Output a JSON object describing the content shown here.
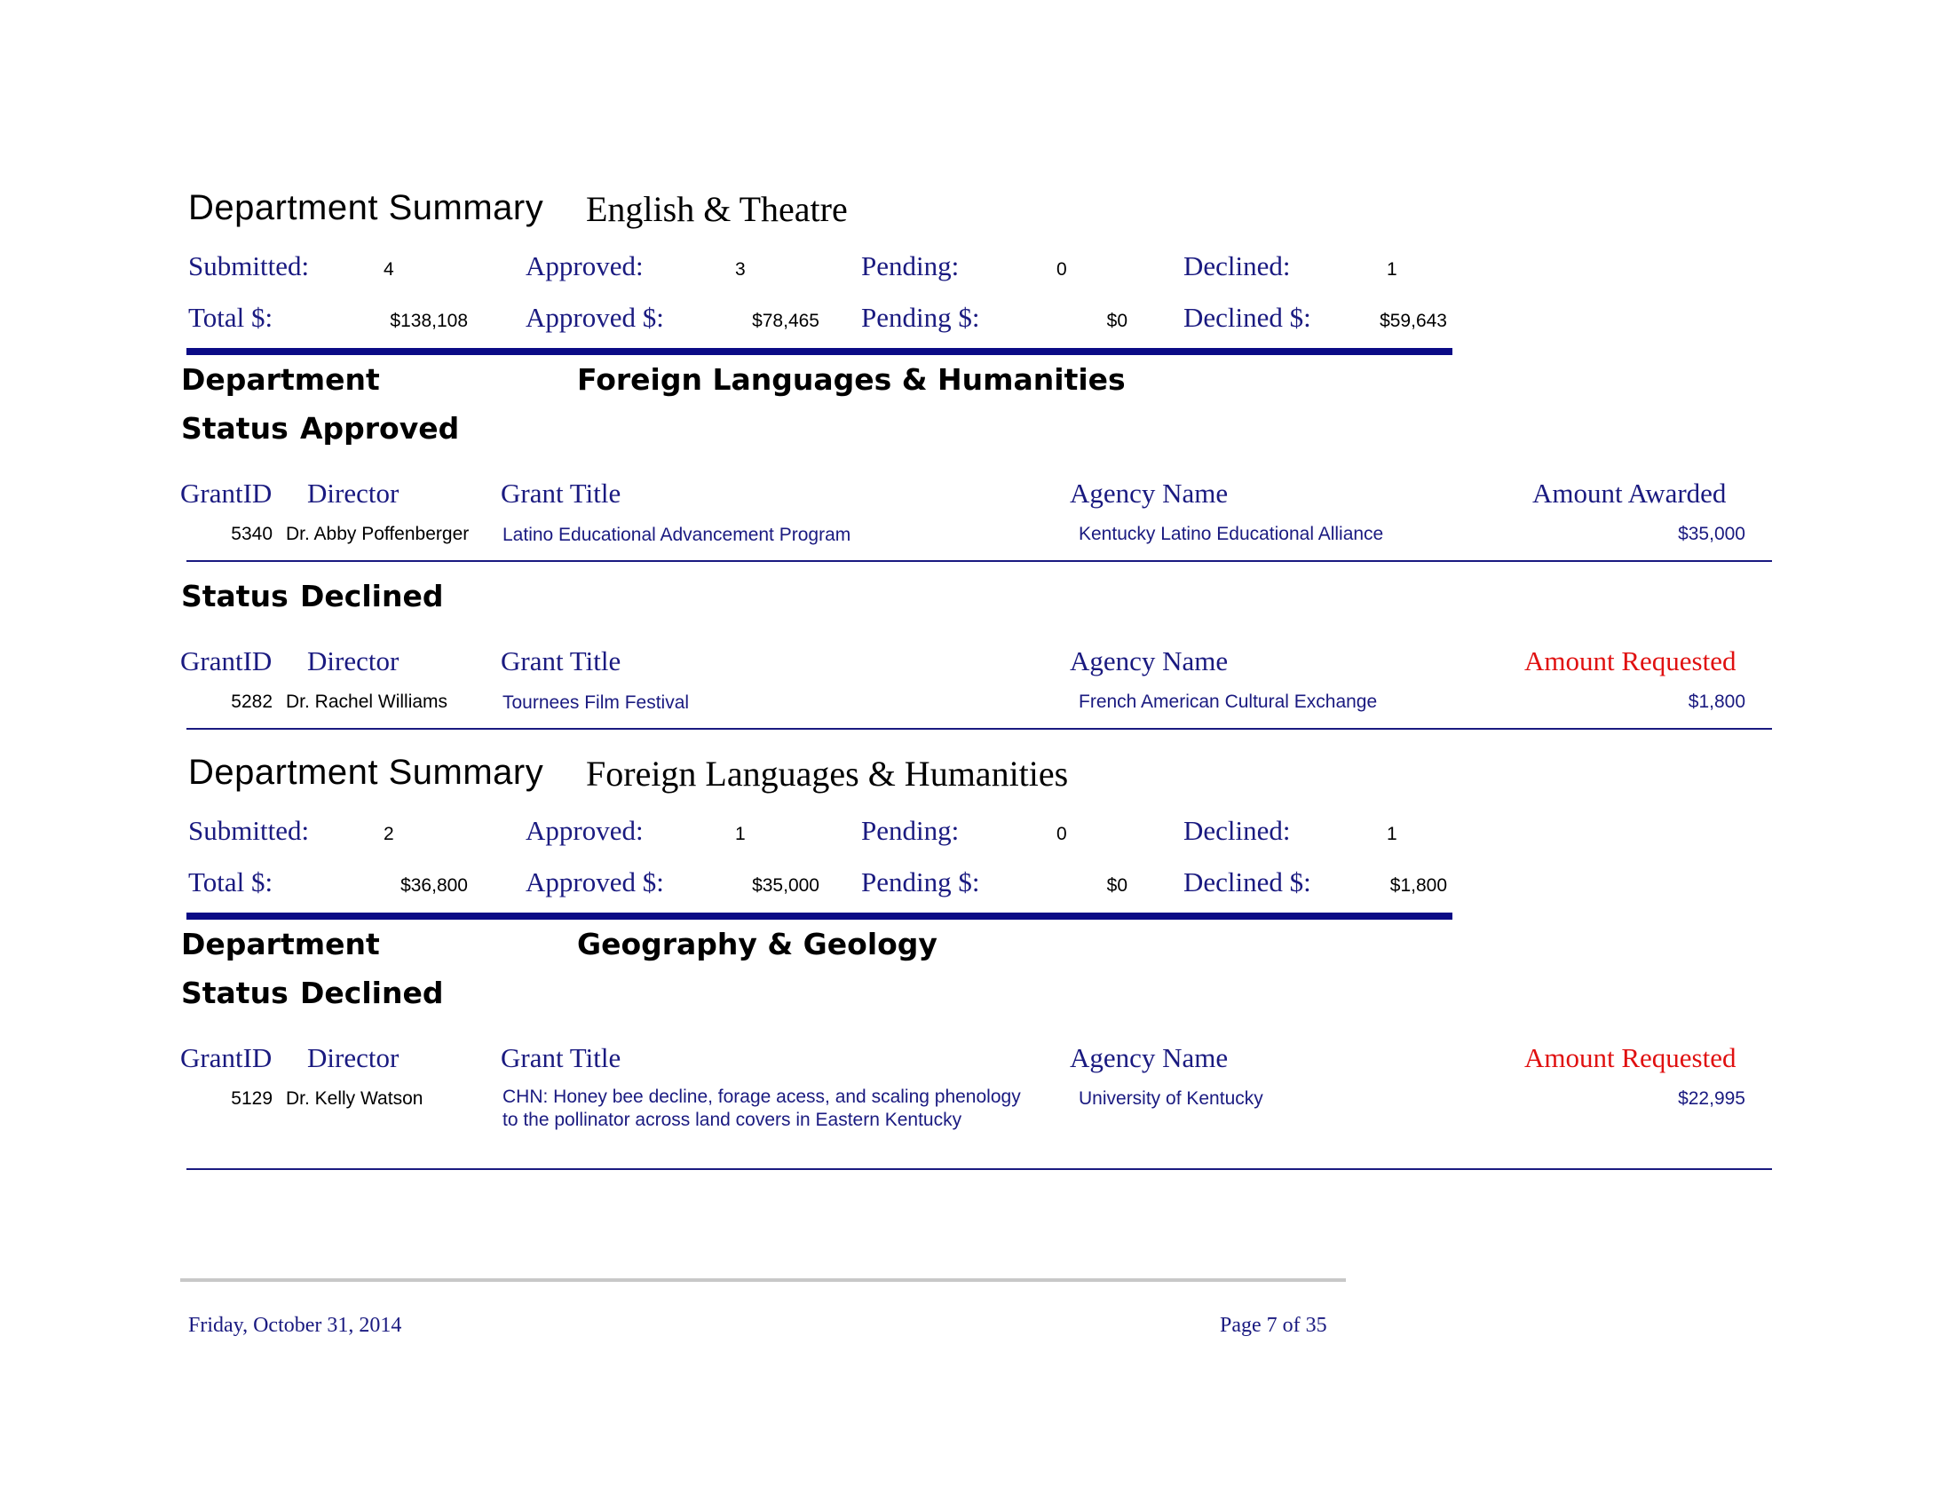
{
  "summary1": {
    "title": "Department Summary",
    "dept": "English & Theatre",
    "submitted_label": "Submitted:",
    "submitted": "4",
    "approved_label": "Approved:",
    "approved": "3",
    "pending_label": "Pending:",
    "pending": "0",
    "declined_label": "Declined:",
    "declined": "1",
    "total_label": "Total $:",
    "total": "$138,108",
    "approved_amt_label": "Approved $:",
    "approved_amt": "$78,465",
    "pending_amt_label": "Pending $:",
    "pending_amt": "$0",
    "declined_amt_label": "Declined $:",
    "declined_amt": "$59,643"
  },
  "section1": {
    "dept_label": "Department",
    "dept_name": "Foreign Languages & Humanities",
    "status_label": "Status",
    "approved_status": "Approved",
    "declined_status": "Declined",
    "headers_approved": {
      "grantid": "GrantID",
      "director": "Director",
      "title": "Grant Title",
      "agency": "Agency Name",
      "amount": "Amount Awarded"
    },
    "headers_declined": {
      "grantid": "GrantID",
      "director": "Director",
      "title": "Grant Title",
      "agency": "Agency Name",
      "amount": "Amount Requested"
    },
    "approved_row": {
      "id": "5340",
      "director": "Dr. Abby Poffenberger",
      "title": "Latino Educational Advancement Program",
      "agency": "Kentucky Latino Educational Alliance",
      "amount": "$35,000"
    },
    "declined_row": {
      "id": "5282",
      "director": "Dr. Rachel Williams",
      "title": "Tournees Film Festival",
      "agency": "French American Cultural Exchange",
      "amount": "$1,800"
    }
  },
  "summary2": {
    "title": "Department Summary",
    "dept": "Foreign Languages & Humanities",
    "submitted_label": "Submitted:",
    "submitted": "2",
    "approved_label": "Approved:",
    "approved": "1",
    "pending_label": "Pending:",
    "pending": "0",
    "declined_label": "Declined:",
    "declined": "1",
    "total_label": "Total $:",
    "total": "$36,800",
    "approved_amt_label": "Approved $:",
    "approved_amt": "$35,000",
    "pending_amt_label": "Pending $:",
    "pending_amt": "$0",
    "declined_amt_label": "Declined $:",
    "declined_amt": "$1,800"
  },
  "section2": {
    "dept_label": "Department",
    "dept_name": "Geography & Geology",
    "status_label": "Status",
    "declined_status": "Declined",
    "headers_declined": {
      "grantid": "GrantID",
      "director": "Director",
      "title": "Grant Title",
      "agency": "Agency Name",
      "amount": "Amount Requested"
    },
    "declined_row": {
      "id": "5129",
      "director": "Dr. Kelly Watson",
      "title": "CHN: Honey bee decline, forage acess, and scaling phenology to the pollinator across land covers in Eastern Kentucky",
      "agency": "University of Kentucky",
      "amount": "$22,995"
    }
  },
  "footer": {
    "date": "Friday, October 31, 2014",
    "page": "Page 7 of 35"
  }
}
